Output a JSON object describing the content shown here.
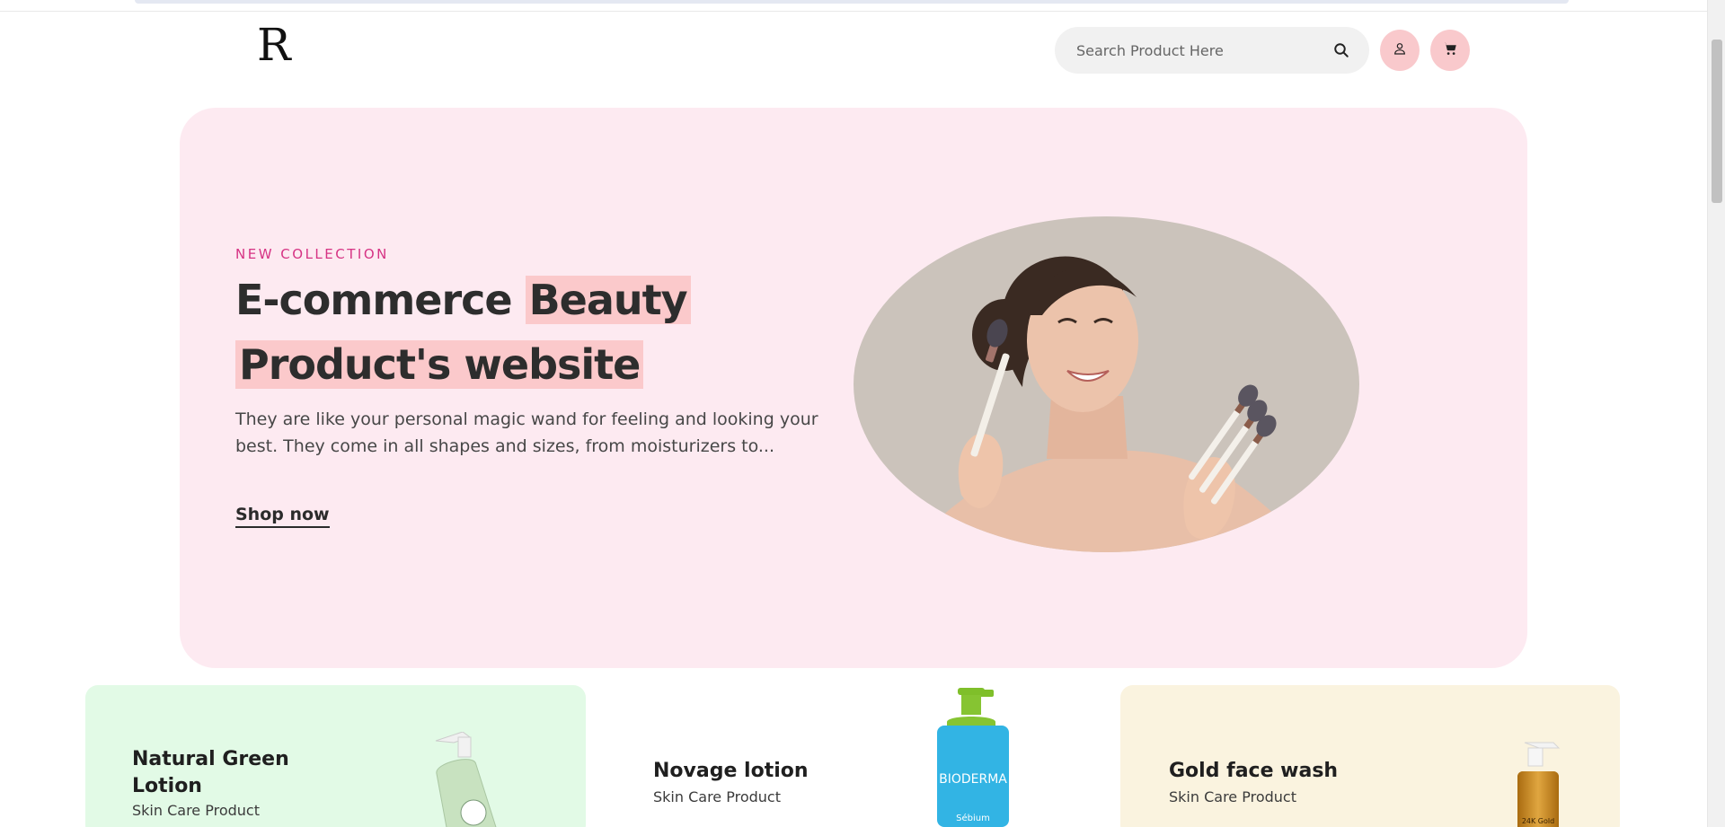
{
  "header": {
    "logo_text": "R",
    "search_placeholder": "Search Product Here",
    "icons": {
      "search": "search-icon",
      "account": "user-icon",
      "cart": "cart-icon"
    },
    "accent_color": "#f9c9cc"
  },
  "hero": {
    "eyebrow": "NEW COLLECTION",
    "title_part1": "E-commerce",
    "title_highlight1": "Beauty",
    "title_highlight2": "Product's website",
    "description": "They are like your personal magic wand for feeling and looking your best. They come in all shapes and sizes, from moisturizers to...",
    "cta": "Shop now",
    "background_color": "#fdeaf1",
    "eyebrow_color": "#d63384"
  },
  "products": [
    {
      "title": "Natural Green Lotion",
      "subtitle": "Skin Care Product",
      "bg": "#e2fae6"
    },
    {
      "title": "Novage lotion",
      "subtitle": "Skin Care Product",
      "bg": "#ffffff",
      "bottle_label": "BIODERMA",
      "bottle_sub": "Sébium"
    },
    {
      "title": "Gold face wash",
      "subtitle": "Skin Care Product",
      "bg": "#faf3df",
      "bottle_label": "24K Gold"
    }
  ]
}
